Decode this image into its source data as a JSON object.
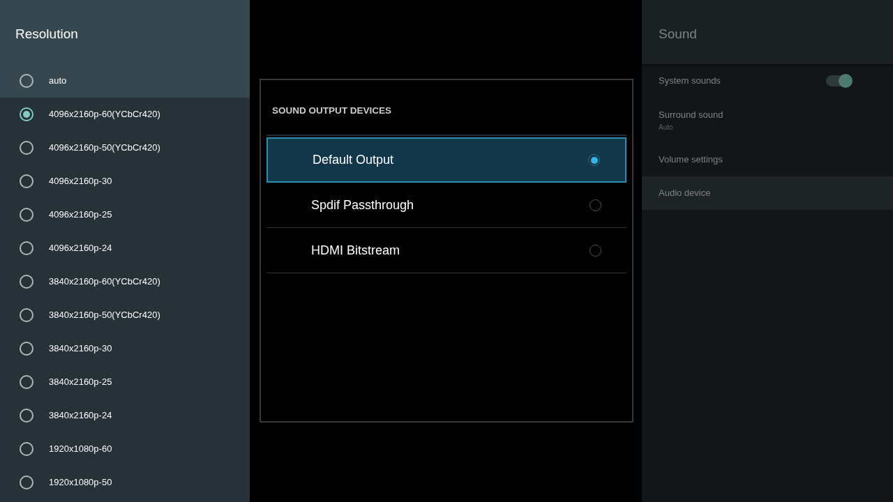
{
  "resolution_panel": {
    "title": "Resolution",
    "items": [
      {
        "label": "auto",
        "selected": false,
        "highlighted": true
      },
      {
        "label": "4096x2160p-60(YCbCr420)",
        "selected": true,
        "highlighted": false
      },
      {
        "label": "4096x2160p-50(YCbCr420)",
        "selected": false,
        "highlighted": false
      },
      {
        "label": "4096x2160p-30",
        "selected": false,
        "highlighted": false
      },
      {
        "label": "4096x2160p-25",
        "selected": false,
        "highlighted": false
      },
      {
        "label": "4096x2160p-24",
        "selected": false,
        "highlighted": false
      },
      {
        "label": "3840x2160p-60(YCbCr420)",
        "selected": false,
        "highlighted": false
      },
      {
        "label": "3840x2160p-50(YCbCr420)",
        "selected": false,
        "highlighted": false
      },
      {
        "label": "3840x2160p-30",
        "selected": false,
        "highlighted": false
      },
      {
        "label": "3840x2160p-25",
        "selected": false,
        "highlighted": false
      },
      {
        "label": "3840x2160p-24",
        "selected": false,
        "highlighted": false
      },
      {
        "label": "1920x1080p-60",
        "selected": false,
        "highlighted": false
      },
      {
        "label": "1920x1080p-50",
        "selected": false,
        "highlighted": false
      }
    ]
  },
  "dialog": {
    "title": "SOUND OUTPUT DEVICES",
    "options": [
      {
        "label": "Default Output",
        "selected": true
      },
      {
        "label": "Spdif Passthrough",
        "selected": false
      },
      {
        "label": "HDMI Bitstream",
        "selected": false
      }
    ]
  },
  "sound_panel": {
    "title": "Sound",
    "items": [
      {
        "kind": "toggle",
        "label": "System sounds",
        "on": true,
        "highlighted": false
      },
      {
        "kind": "text",
        "label": "Surround sound",
        "summary": "Auto",
        "highlighted": false
      },
      {
        "kind": "text",
        "label": "Volume settings",
        "highlighted": false
      },
      {
        "kind": "text",
        "label": "Audio device",
        "highlighted": true
      }
    ]
  }
}
